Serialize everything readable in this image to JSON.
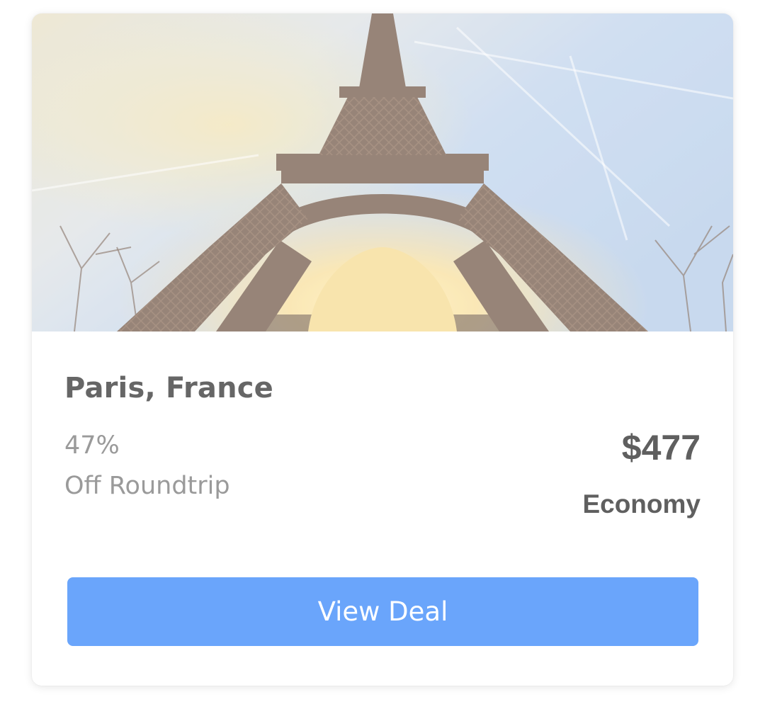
{
  "deal": {
    "destination": "Paris, France",
    "discount": "47%",
    "discount_note": "Off Roundtrip",
    "price": "$477",
    "cabin_class": "Economy",
    "cta_label": "View Deal"
  },
  "hero_image": {
    "subject": "Eiffel Tower at sunset"
  },
  "colors": {
    "button": "#6aa5fb",
    "title_text": "#666666",
    "secondary_text": "#9a9a9a",
    "price_text": "#5f5f5f",
    "card_background": "#ffffff"
  }
}
